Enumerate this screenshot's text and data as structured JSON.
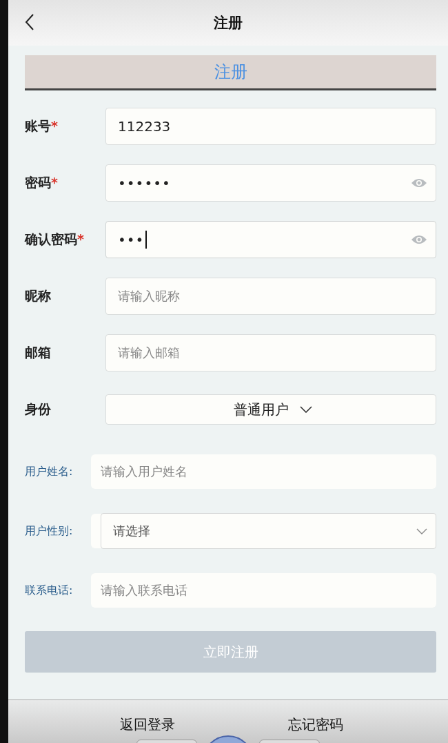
{
  "header": {
    "title": "注册"
  },
  "banner": {
    "title": "注册"
  },
  "fields": [
    {
      "kind": "text",
      "label": "账号",
      "mark": "*",
      "value": "112233"
    },
    {
      "kind": "password",
      "label": "密码",
      "mark": "*",
      "value": "••••••",
      "focused": false
    },
    {
      "kind": "password",
      "label": "确认密码",
      "mark": "*",
      "value": "•••",
      "focused": true
    },
    {
      "kind": "text",
      "label": "昵称",
      "placeholder": "请输入昵称"
    },
    {
      "kind": "text",
      "label": "邮箱",
      "placeholder": "请输入邮箱"
    },
    {
      "kind": "picker",
      "label": "身份",
      "value": "普通用户"
    },
    {
      "kind": "plain-text",
      "label": "用户姓名:",
      "placeholder": "请输入用户姓名"
    },
    {
      "kind": "plain-select",
      "label": "用户性别:",
      "placeholder": "请选择"
    },
    {
      "kind": "plain-text",
      "label": "联系电话:",
      "placeholder": "请输入联系电话"
    }
  ],
  "submit": {
    "label": "立即注册",
    "disabled": true
  },
  "footer": {
    "links": [
      "返回登录",
      "忘记密码"
    ]
  }
}
